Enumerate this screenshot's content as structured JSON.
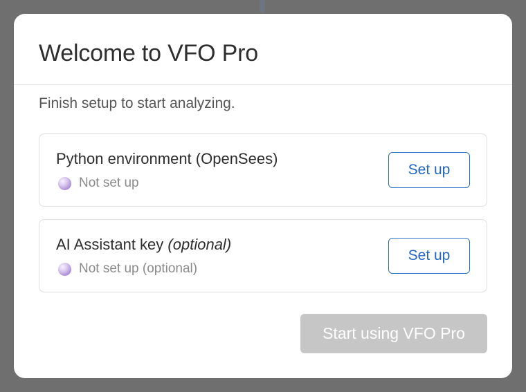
{
  "dialog": {
    "title": "Welcome to VFO Pro",
    "subtitle": "Finish setup to start analyzing."
  },
  "items": [
    {
      "title": "Python environment (OpenSees)",
      "optional_suffix": "",
      "status": "Not set up",
      "button_label": "Set up"
    },
    {
      "title": "AI Assistant key",
      "optional_suffix": "(optional)",
      "status": "Not set up (optional)",
      "button_label": "Set up"
    }
  ],
  "footer": {
    "primary_label": "Start using VFO Pro",
    "primary_enabled": false
  },
  "colors": {
    "accent": "#2266c2",
    "disabled_button": "#c6c6c6",
    "status_dot": "#b39ddb",
    "backdrop": "#6f6f6f"
  },
  "icons": {
    "status": "status-dot-icon"
  }
}
